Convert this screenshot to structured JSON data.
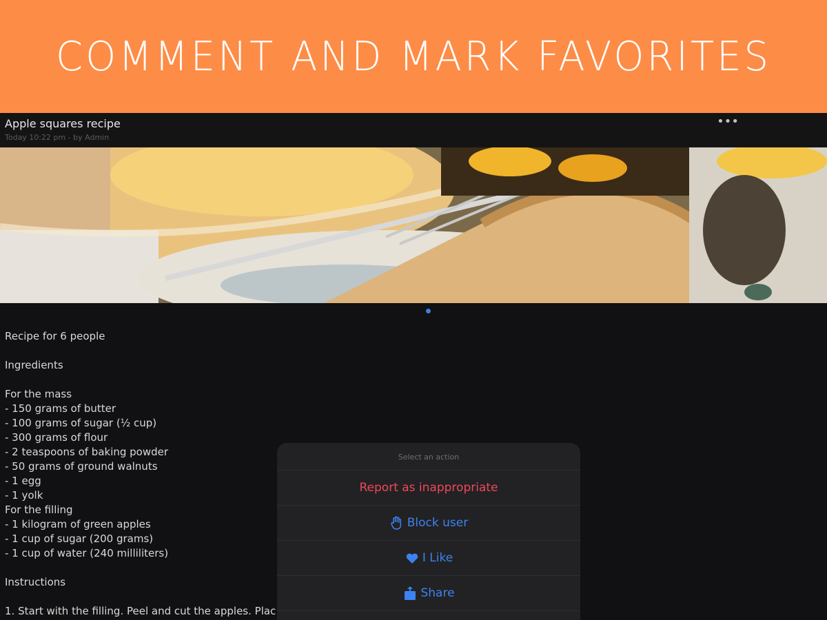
{
  "banner": {
    "title": "COMMENT AND MARK FAVORITES"
  },
  "post": {
    "title": "Apple squares recipe",
    "meta": "Today 10:22 pm - by Admin",
    "more_icon": "more-horizontal-icon"
  },
  "carousel": {
    "pages": 1,
    "current": 1
  },
  "content": {
    "lines": [
      "Recipe for 6 people",
      "",
      "Ingredients",
      "",
      "For the mass",
      "- 150 grams of butter",
      "- 100 grams of sugar (½ cup)",
      "- 300 grams of flour",
      "- 2 teaspoons of baking powder",
      "- 50 grams of ground walnuts",
      "- 1 egg",
      "- 1 yolk",
      "For the filling",
      "- 1 kilogram of green apples",
      "- 1 cup of sugar (200 grams)",
      "- 1 cup of water (240 milliliters)",
      "",
      "Instructions",
      "",
      "1. Start with the filling. Peel and cut the apples. Plac"
    ]
  },
  "action_sheet": {
    "title": "Select an action",
    "items": [
      {
        "label": "Report as inappropriate",
        "icon": "",
        "style": "danger"
      },
      {
        "label": "Block user",
        "icon": "hand-stop-icon",
        "style": "normal"
      },
      {
        "label": "I Like",
        "icon": "heart-icon",
        "style": "normal"
      },
      {
        "label": "Share",
        "icon": "share-icon",
        "style": "normal"
      }
    ]
  },
  "colors": {
    "banner": "#fd8c47",
    "background": "#111113",
    "accent_blue": "#3d82f0",
    "danger_red": "#f0475a"
  }
}
